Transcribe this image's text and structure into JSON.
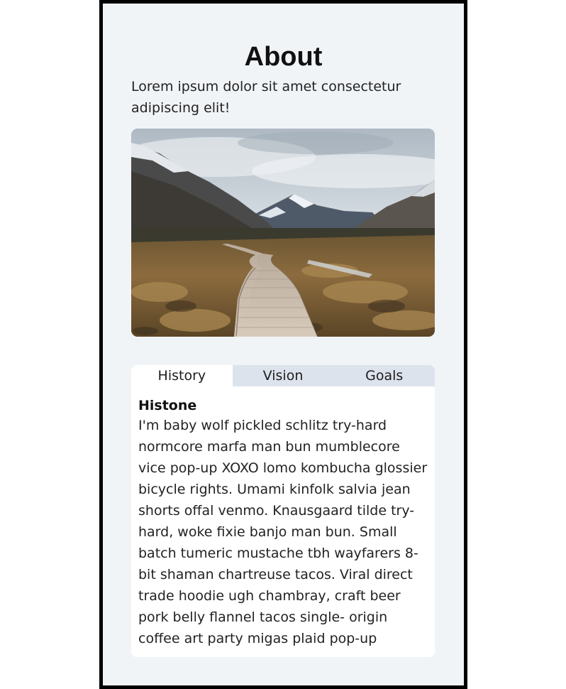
{
  "page": {
    "title": "About",
    "intro": "Lorem ipsum dolor sit amet consectetur adipiscing elit!"
  },
  "hero_image": {
    "alt": "Wooden boardwalk through golden grassland toward snow-capped mountains"
  },
  "tabs": {
    "items": [
      {
        "label": "History",
        "active": true
      },
      {
        "label": "Vision",
        "active": false
      },
      {
        "label": "Goals",
        "active": false
      }
    ],
    "panel": {
      "heading": "Histone",
      "body": "I'm baby wolf pickled schlitz try-hard normcore marfa man bun mumblecore vice pop-up XOXO lomo kombucha glossier bicycle rights. Umami kinfolk salvia jean shorts offal venmo. Knausgaard tilde try- hard, woke fixie banjo man bun. Small batch tumeric mustache tbh wayfarers 8-bit shaman chartreuse tacos. Viral direct trade hoodie ugh chambray, craft beer pork belly flannel tacos single- origin coffee art party migas plaid pop-up"
    }
  },
  "colors": {
    "page_background": "#f1f4f7",
    "frame_border": "#000000",
    "tab_bar": "#dde3ec",
    "card": "#ffffff"
  }
}
